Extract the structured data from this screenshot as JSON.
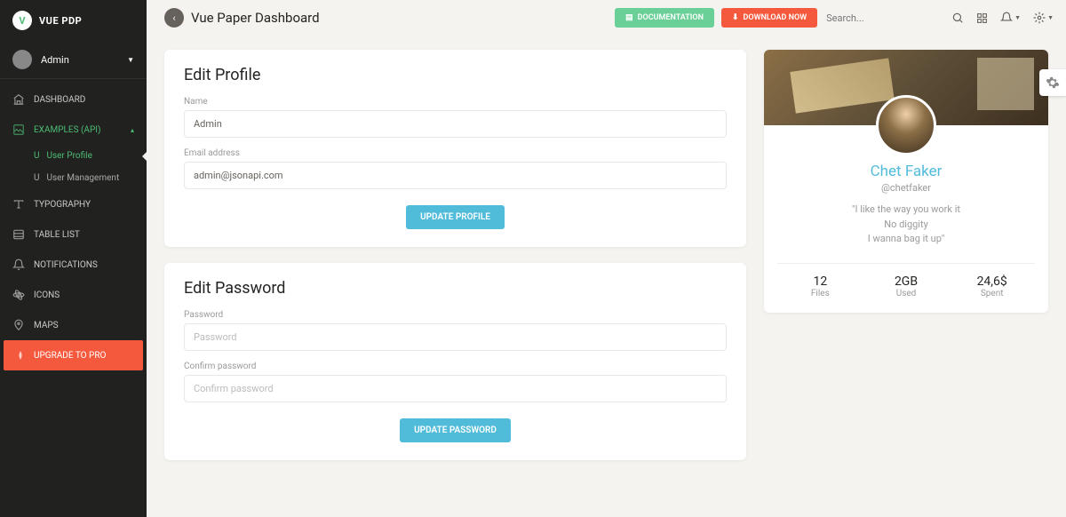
{
  "brand": "VUE PDP",
  "sidebar": {
    "user": "Admin",
    "items": [
      {
        "icon": "bank",
        "label": "DASHBOARD"
      },
      {
        "icon": "image",
        "label": "EXAMPLES (API)",
        "active": true,
        "expand": true
      },
      {
        "icon": "text",
        "label": "TYPOGRAPHY"
      },
      {
        "icon": "list",
        "label": "TABLE LIST"
      },
      {
        "icon": "bell",
        "label": "NOTIFICATIONS"
      },
      {
        "icon": "atom",
        "label": "ICONS"
      },
      {
        "icon": "pin",
        "label": "MAPS"
      }
    ],
    "sub": [
      {
        "letter": "U",
        "label": "User Profile",
        "active": true
      },
      {
        "letter": "U",
        "label": "User Management"
      }
    ],
    "upgrade": "UPGRADE TO PRO"
  },
  "header": {
    "title": "Vue Paper Dashboard",
    "doc_btn": "DOCUMENTATION",
    "download_btn": "DOWNLOAD NOW",
    "search_placeholder": "Search..."
  },
  "edit_profile": {
    "title": "Edit Profile",
    "name_label": "Name",
    "name_value": "Admin",
    "email_label": "Email address",
    "email_value": "admin@jsonapi.com",
    "submit": "UPDATE PROFILE"
  },
  "edit_password": {
    "title": "Edit Password",
    "pw_label": "Password",
    "pw_placeholder": "Password",
    "confirm_label": "Confirm password",
    "confirm_placeholder": "Confirm password",
    "submit": "UPDATE PASSWORD"
  },
  "profile": {
    "name": "Chet Faker",
    "handle": "@chetfaker",
    "quote1": "\"I like the way you work it",
    "quote2": "No diggity",
    "quote3": "I wanna bag it up\"",
    "stats": [
      {
        "val": "12",
        "lbl": "Files"
      },
      {
        "val": "2GB",
        "lbl": "Used"
      },
      {
        "val": "24,6$",
        "lbl": "Spent"
      }
    ]
  }
}
